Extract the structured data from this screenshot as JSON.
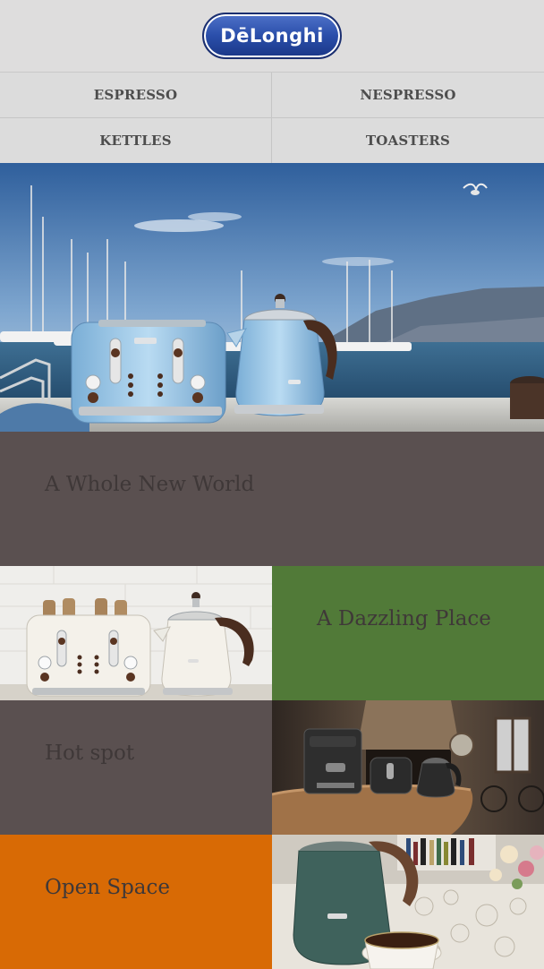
{
  "brand": {
    "logo_text": "DēLonghi"
  },
  "nav": {
    "items": [
      {
        "label": "ESPRESSO"
      },
      {
        "label": "NESPRESSO"
      },
      {
        "label": "KETTLES"
      },
      {
        "label": "TOASTERS"
      }
    ]
  },
  "tiles": {
    "whole_new_world": {
      "title": "A Whole New World",
      "bg": "#5a5050"
    },
    "dazzling_place": {
      "title": "A Dazzling Place",
      "bg": "#517a38"
    },
    "hot_spot": {
      "title": "Hot spot",
      "bg": "#5a5050"
    },
    "open_space": {
      "title": "Open Space",
      "bg": "#d86a05"
    }
  },
  "colors": {
    "header_bg": "#dedddd",
    "nav_text": "#4d4d4d",
    "title_text": "#3f3838",
    "logo_blue": "#2a4eaa"
  }
}
